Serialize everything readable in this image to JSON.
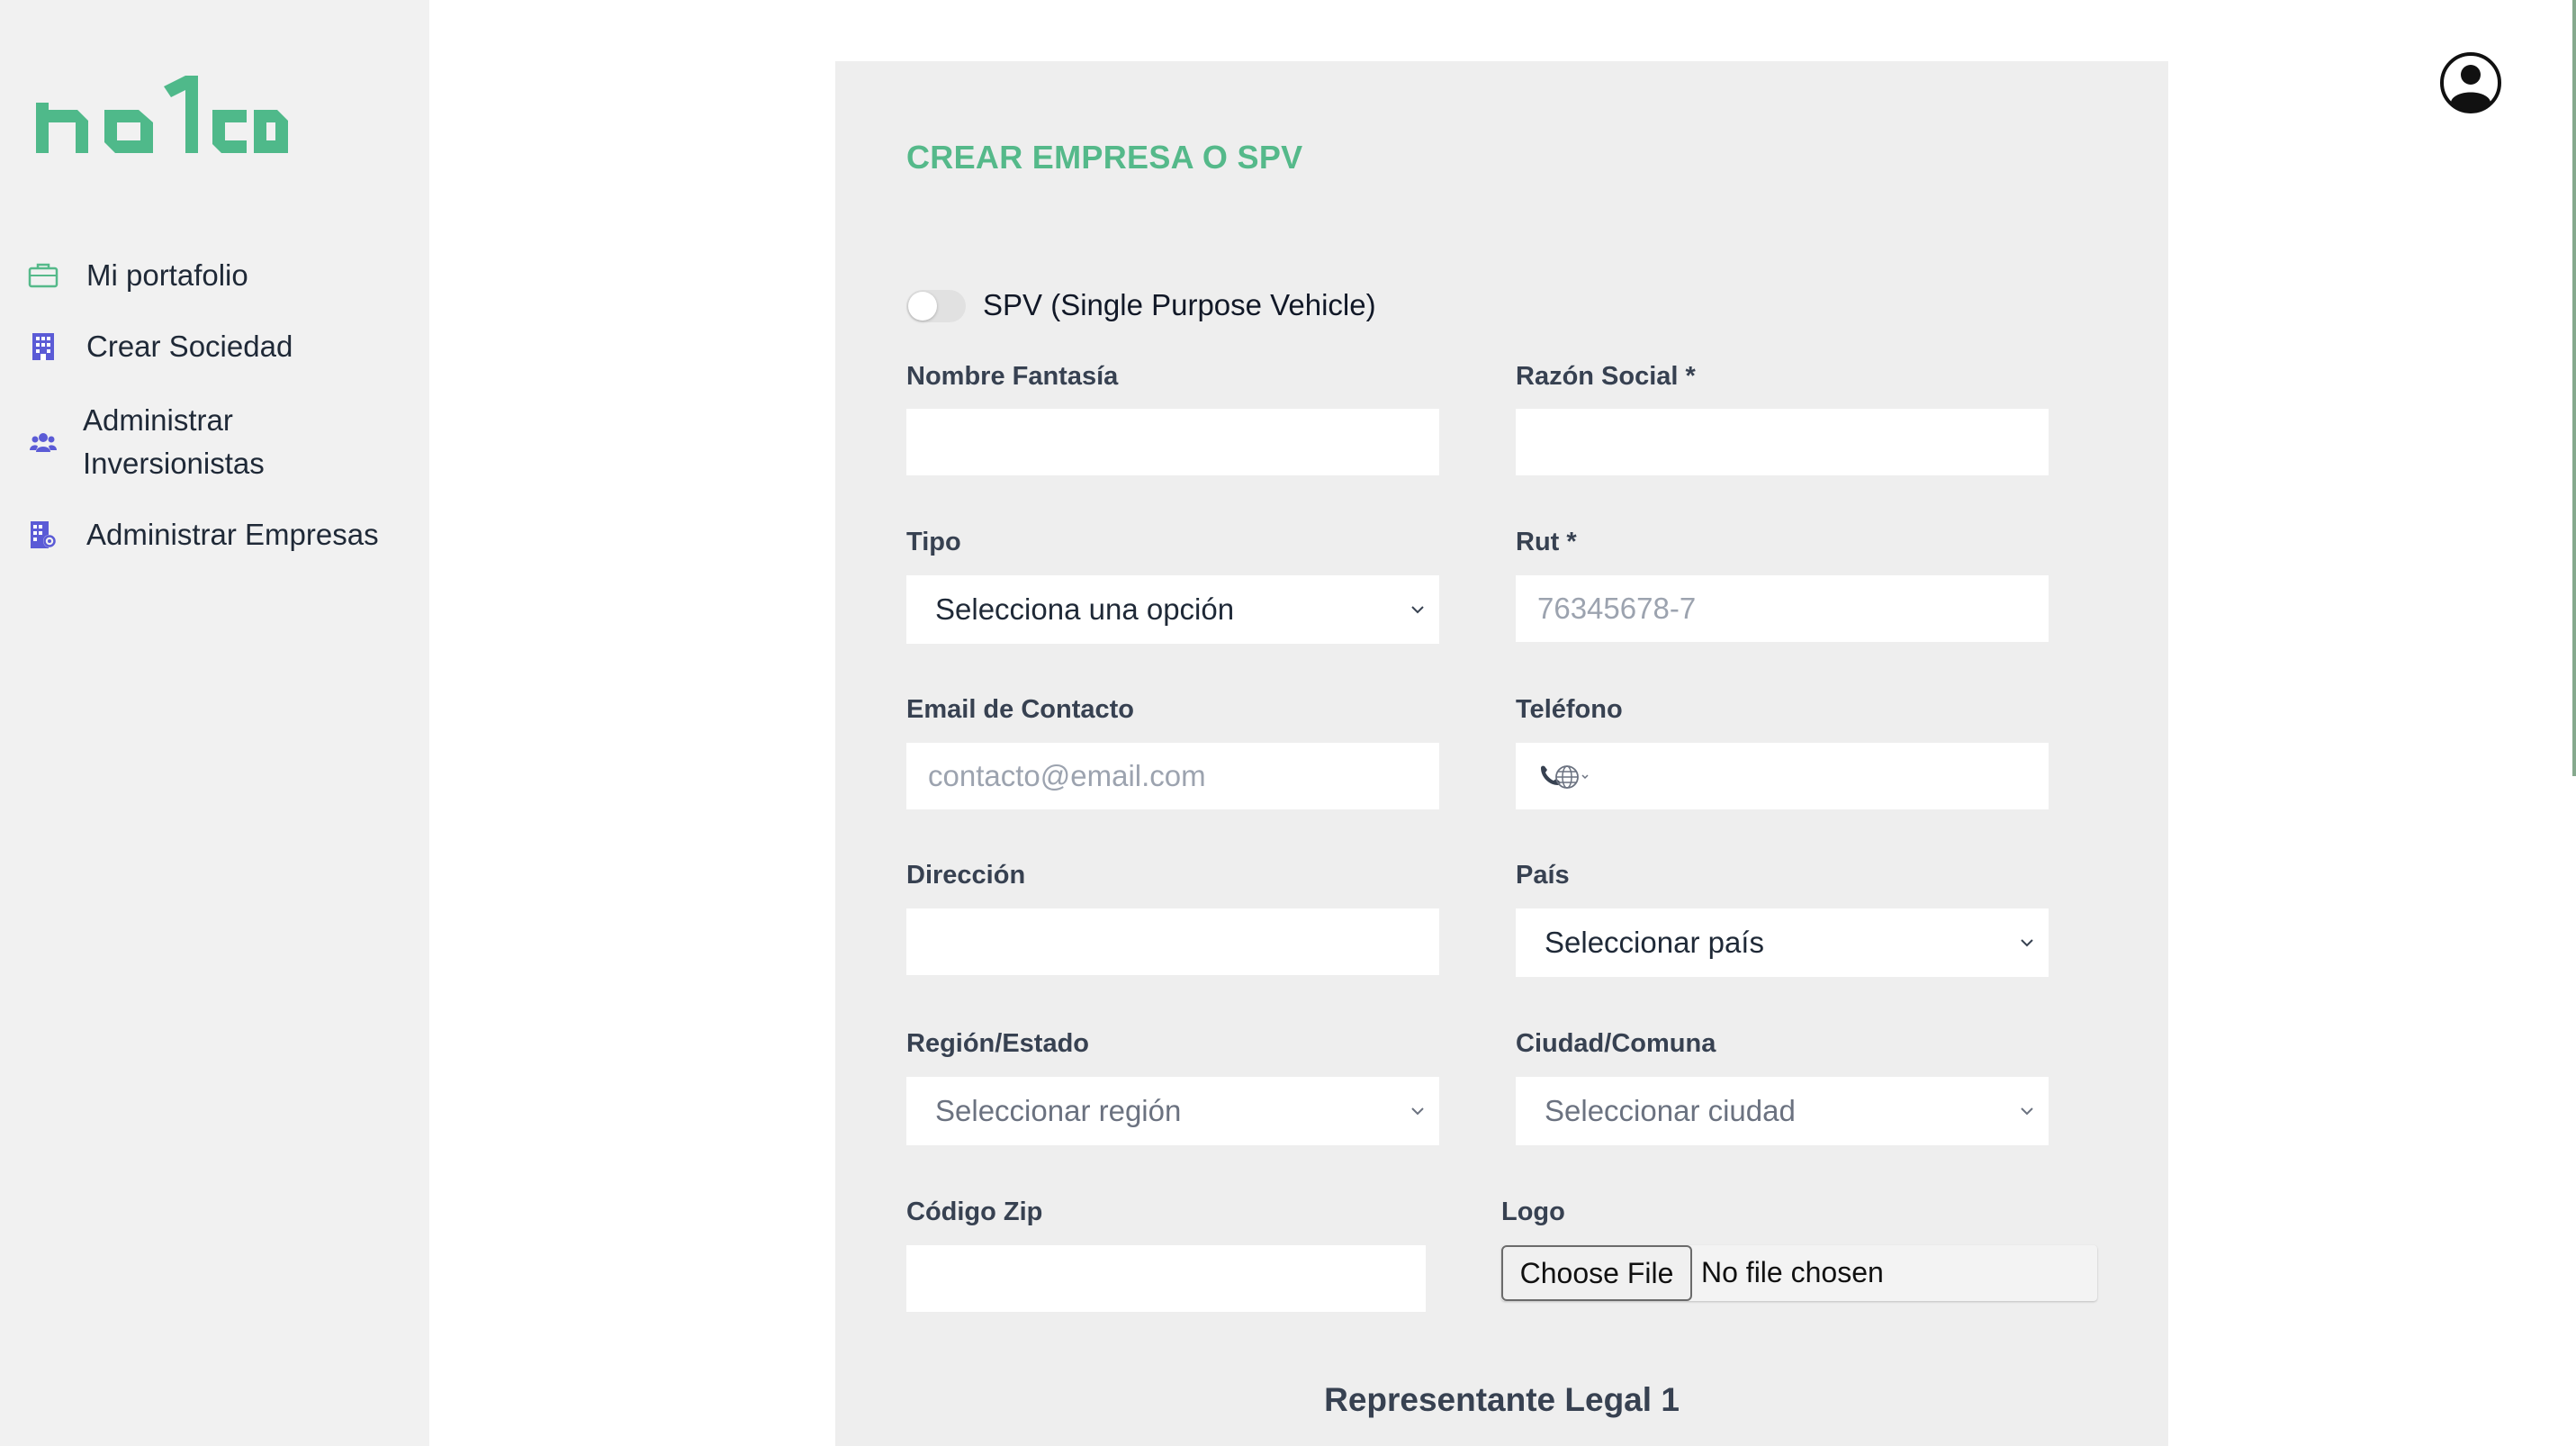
{
  "brand": {
    "logo_text": "nolco",
    "accent_color": "#55b98a"
  },
  "sidebar": {
    "items": [
      {
        "label": "Mi portafolio",
        "icon": "briefcase-icon"
      },
      {
        "label": "Crear Sociedad",
        "icon": "building-icon"
      },
      {
        "label": "Administrar Inversionistas",
        "icon": "users-icon"
      },
      {
        "label": "Administrar Empresas",
        "icon": "building-gear-icon"
      }
    ]
  },
  "header": {
    "avatar_icon": "user-circle-icon"
  },
  "form": {
    "title": "CREAR EMPRESA O SPV",
    "spv_toggle": {
      "label": "SPV (Single Purpose Vehicle)",
      "on": false
    },
    "nombre_fantasia": {
      "label": "Nombre Fantasía",
      "value": ""
    },
    "razon_social": {
      "label": "Razón Social *",
      "value": ""
    },
    "tipo": {
      "label": "Tipo",
      "selected": "Selecciona una opción"
    },
    "rut": {
      "label": "Rut *",
      "placeholder": "76345678-7"
    },
    "email": {
      "label": "Email de Contacto",
      "placeholder": "contacto@email.com"
    },
    "telefono": {
      "label": "Teléfono",
      "value": ""
    },
    "direccion": {
      "label": "Dirección",
      "value": ""
    },
    "pais": {
      "label": "País",
      "selected": "Seleccionar país"
    },
    "region": {
      "label": "Región/Estado",
      "selected": "Seleccionar región"
    },
    "ciudad": {
      "label": "Ciudad/Comuna",
      "selected": "Seleccionar ciudad"
    },
    "codigo_zip": {
      "label": "Código Zip",
      "value": ""
    },
    "logo": {
      "label": "Logo",
      "button": "Choose File",
      "status": "No file chosen"
    },
    "section_representante": "Representante Legal 1"
  }
}
